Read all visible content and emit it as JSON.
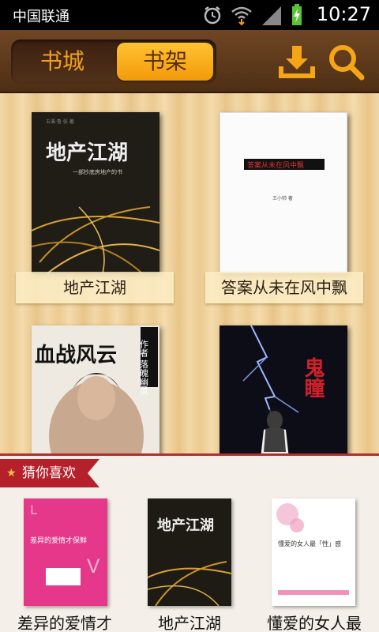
{
  "status": {
    "carrier": "中国联通",
    "time": "10:27"
  },
  "header": {
    "tabs": [
      "书城",
      "书架"
    ],
    "active_tab": "书架"
  },
  "shelf": {
    "books": [
      {
        "title": "地产江湖",
        "cover_title": "地产江湖",
        "cover_sub": "一部抄底房地产的书",
        "cover_top": "五溪·鲁·张 著"
      },
      {
        "title": "答案从未在风中飘",
        "cover_title": "答案从未在风中飘",
        "cover_author": "王小帅 著"
      },
      {
        "title": "",
        "cover_title": "血战风云",
        "cover_side": "作者 落魄幽灵",
        "seal": "原"
      },
      {
        "title": "",
        "cover_title": "鬼瞳",
        "seal": "原"
      }
    ]
  },
  "recs": {
    "heading": "猜你喜欢",
    "items": [
      {
        "title": "差异的爱情才",
        "cover_title": "差异的爱情才保鲜"
      },
      {
        "title": "地产江湖",
        "cover_title": "地产江湖"
      },
      {
        "title": "懂爱的女人最",
        "cover_title": "懂爱的女人最「性」感"
      }
    ]
  },
  "colors": {
    "accent": "#f39a09",
    "header_brown": "#5a3a1c",
    "rec_red": "#b5202a"
  }
}
